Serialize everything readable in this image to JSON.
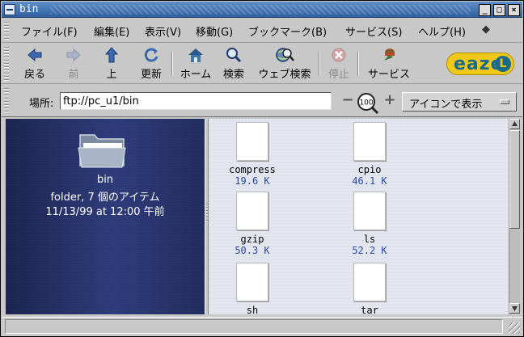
{
  "window": {
    "title": "bin"
  },
  "menubar": {
    "items": [
      {
        "label": "ファイル(F)"
      },
      {
        "label": "編集(E)"
      },
      {
        "label": "表示(V)"
      },
      {
        "label": "移動(G)"
      },
      {
        "label": "ブックマーク(B)"
      },
      {
        "label": "サービス(S)"
      },
      {
        "label": "ヘルプ(H)"
      },
      {
        "label": "◆"
      }
    ]
  },
  "toolbar": {
    "back": "戻る",
    "forward": "前",
    "up": "上",
    "reload": "更新",
    "home": "ホーム",
    "search": "検索",
    "web_search": "ウェブ検索",
    "stop": "停止",
    "services": "サービス",
    "logo": "eaze",
    "logo_mark": "L"
  },
  "location": {
    "label": "場所:",
    "value": "ftp://pc_u1/bin",
    "zoom_level": "100",
    "zoom_minus": "−",
    "zoom_plus": "+",
    "view_mode": "アイコンで表示"
  },
  "sidebar": {
    "name": "bin",
    "summary": "folder, 7 個のアイテム",
    "date": "11/13/99 at 12:00 午前"
  },
  "files": [
    {
      "name": "compress",
      "size": "19.6 K"
    },
    {
      "name": "cpio",
      "size": "46.1 K"
    },
    {
      "name": "gzip",
      "size": "50.3 K"
    },
    {
      "name": "ls",
      "size": "52.2 K"
    },
    {
      "name": "sh",
      "size": ""
    },
    {
      "name": "tar",
      "size": ""
    }
  ],
  "colors": {
    "sidebar_bg": "#2e3b7a",
    "file_size_text": "#2a4aa0",
    "titlebar": "#4a78b4",
    "logo": "#f0c81a"
  }
}
